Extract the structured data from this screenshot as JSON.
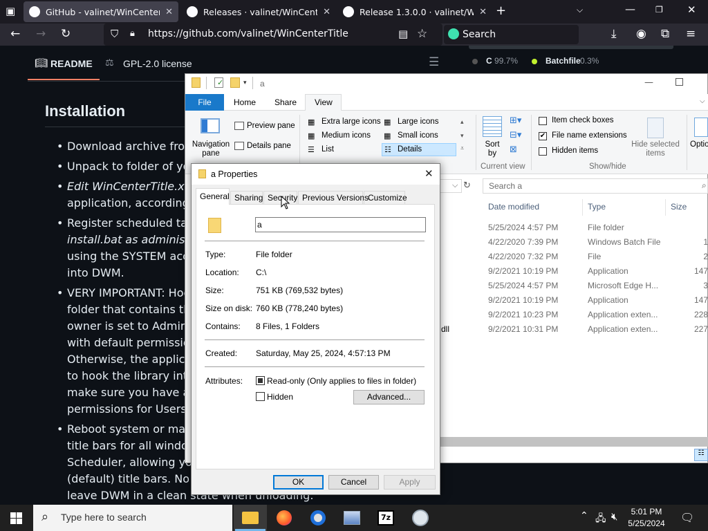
{
  "browser": {
    "tabs": [
      {
        "title": "GitHub - valinet/WinCenterTitle"
      },
      {
        "title": "Releases · valinet/WinCenterTitle"
      },
      {
        "title": "Release 1.3.0.0 · valinet/WinCenterTitle"
      }
    ],
    "url": "https://github.com/valinet/WinCenterTitle",
    "search_placeholder": "Search"
  },
  "github": {
    "tab_readme": "README",
    "tab_license": "GPL-2.0 license",
    "heading": "Installation",
    "lines": [
      "Download archive from",
      "Unpack to folder of your",
      "Edit WinCenterTitle.xml a",
      "application, according to",
      "Register scheduled task t",
      "install.bat as administrat",
      "using the SYSTEM accou",
      "into DWM.",
      "VERY IMPORTANT: Hook",
      "folder that contains the",
      "owner is set to Administ",
      "with default permissions",
      "Otherwise, the applicati",
      "to hook the library into",
      "make sure you have a fo",
      "permissions for Users g",
      "Reboot system or manua",
      "title bars for all windows",
      "Scheduler, allowing you",
      "(default) title bars. No DW",
      "leave DWM in a clean state when unloading."
    ],
    "languages": [
      {
        "name": "C",
        "pct": "99.7%",
        "color": "#555555"
      },
      {
        "name": "Batchfile",
        "pct": "0.3%",
        "color": "#c1f12e"
      }
    ]
  },
  "explorer": {
    "title": "a",
    "ribbon_tabs": [
      "File",
      "Home",
      "Share",
      "View"
    ],
    "panes": {
      "nav": "Navigation\npane",
      "preview": "Preview pane",
      "details": "Details pane"
    },
    "layout": [
      "Extra large icons",
      "Large icons",
      "Medium icons",
      "Small icons",
      "List",
      "Details"
    ],
    "sort_by": "Sort\nby",
    "current_view": "Current view",
    "show_hide": {
      "item_check_boxes": "Item check boxes",
      "file_name_extensions": "File name extensions",
      "hidden_items": "Hidden items",
      "hide_selected": "Hide selected\nitems",
      "options": "Optio",
      "label": "Show/hide"
    },
    "search_placeholder": "Search a",
    "columns": [
      "Date modified",
      "Type",
      "Size"
    ],
    "rows": [
      {
        "date": "5/25/2024 4:57 PM",
        "type": "File folder",
        "size": ""
      },
      {
        "date": "4/22/2020 7:39 PM",
        "type": "Windows Batch File",
        "size": "1"
      },
      {
        "date": "4/22/2020 7:32 PM",
        "type": "File",
        "size": "2"
      },
      {
        "date": "9/2/2021 10:19 PM",
        "type": "Application",
        "size": "147"
      },
      {
        "date": "5/25/2024 4:57 PM",
        "type": "Microsoft Edge H...",
        "size": "3"
      },
      {
        "date": "9/2/2021 10:19 PM",
        "type": "Application",
        "size": "147"
      },
      {
        "date": "9/2/2021 10:23 PM",
        "type": "Application exten...",
        "size": "228"
      },
      {
        "date": "9/2/2021 10:31 PM",
        "type": "Application exten...",
        "size": "227"
      }
    ],
    "partial_name": "dll"
  },
  "dialog": {
    "title": "a Properties",
    "tabs": [
      "General",
      "Sharing",
      "Security",
      "Previous Versions",
      "Customize"
    ],
    "name_value": "a",
    "props": [
      {
        "label": "Type:",
        "value": "File folder"
      },
      {
        "label": "Location:",
        "value": "C:\\"
      },
      {
        "label": "Size:",
        "value": "751 KB (769,532 bytes)"
      },
      {
        "label": "Size on disk:",
        "value": "760 KB (778,240 bytes)"
      },
      {
        "label": "Contains:",
        "value": "8 Files, 1 Folders"
      }
    ],
    "created_label": "Created:",
    "created_value": "Saturday, May 25, 2024, 4:57:13 PM",
    "attributes_label": "Attributes:",
    "readonly_label": "Read-only (Only applies to files in folder)",
    "hidden_label": "Hidden",
    "advanced_label": "Advanced...",
    "ok": "OK",
    "cancel": "Cancel",
    "apply": "Apply"
  },
  "taskbar": {
    "search_placeholder": "Type here to search",
    "time": "5:01 PM",
    "date": "5/25/2024"
  }
}
